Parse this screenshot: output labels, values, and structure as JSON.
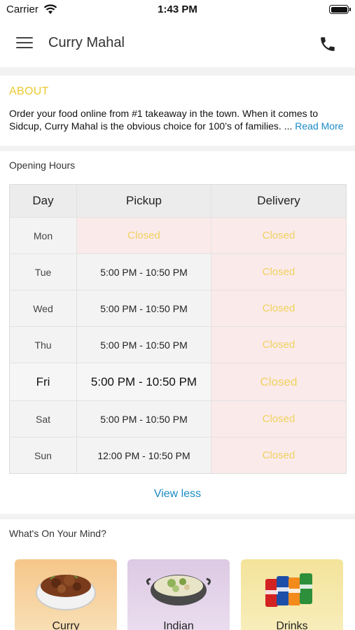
{
  "status_bar": {
    "carrier": "Carrier",
    "time": "1:43 PM"
  },
  "header": {
    "title": "Curry Mahal"
  },
  "about": {
    "title": "ABOUT",
    "text": "Order your food online from #1 takeaway in the town. When it comes to Sidcup, Curry Mahal is the obvious choice for 100’s of families. ...",
    "read_more": "Read More"
  },
  "hours": {
    "title": "Opening Hours",
    "columns": [
      "Day",
      "Pickup",
      "Delivery"
    ],
    "rows": [
      {
        "day": "Mon",
        "pickup": "Closed",
        "delivery": "Closed"
      },
      {
        "day": "Tue",
        "pickup": "5:00 PM - 10:50 PM",
        "delivery": "Closed"
      },
      {
        "day": "Wed",
        "pickup": "5:00 PM - 10:50 PM",
        "delivery": "Closed"
      },
      {
        "day": "Thu",
        "pickup": "5:00 PM - 10:50 PM",
        "delivery": "Closed"
      },
      {
        "day": "Fri",
        "pickup": "5:00 PM - 10:50 PM",
        "delivery": "Closed"
      },
      {
        "day": "Sat",
        "pickup": "5:00 PM - 10:50 PM",
        "delivery": "Closed"
      },
      {
        "day": "Sun",
        "pickup": "12:00 PM - 10:50 PM",
        "delivery": "Closed"
      }
    ],
    "view_less": "View less"
  },
  "mind": {
    "title": "What's On Your Mind?",
    "categories": [
      {
        "label": "Curry",
        "icon": "curry-bowl-icon"
      },
      {
        "label": "Indian",
        "icon": "indian-dish-icon"
      },
      {
        "label": "Drinks",
        "icon": "drink-cans-icon"
      }
    ]
  },
  "colors": {
    "accent_yellow": "#ecc930",
    "link_blue": "#1a8ac4",
    "closed_bg": "#fbeaea",
    "closed_text": "#efd25f"
  }
}
